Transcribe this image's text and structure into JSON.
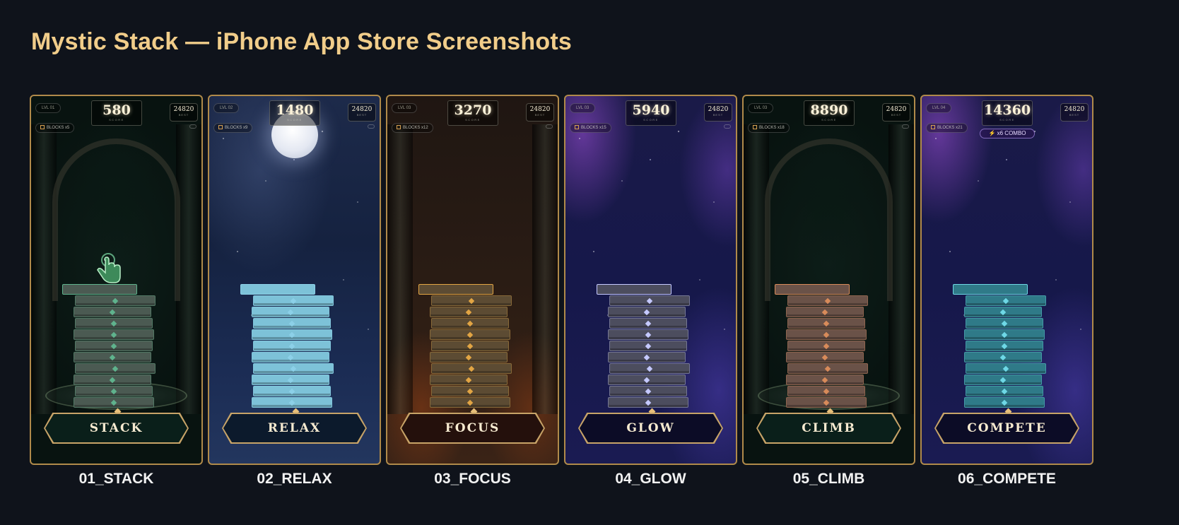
{
  "page": {
    "title": "Mystic Stack — iPhone App Store Screenshots"
  },
  "hud": {
    "score_label": "SCORE",
    "best_label": "BEST",
    "best_value": "24820"
  },
  "screens": [
    {
      "caption": "01_STACK",
      "banner": "STACK",
      "score": "580",
      "level": "LVL 01",
      "blocks": "BLOCKS x5",
      "theme": "forest",
      "accent": "#5fb38d",
      "block_color": "#4b5a52",
      "banner_bg": "#0a1f1a",
      "combo": ""
    },
    {
      "caption": "02_RELAX",
      "banner": "RELAX",
      "score": "1480",
      "level": "LVL 02",
      "blocks": "BLOCKS x9",
      "theme": "moon",
      "accent": "#8cd0e8",
      "block_color": "#7dc2d8",
      "banner_bg": "#0c1a2c",
      "combo": ""
    },
    {
      "caption": "03_FOCUS",
      "banner": "FOCUS",
      "score": "3270",
      "level": "LVL 03",
      "blocks": "BLOCKS x12",
      "theme": "amber",
      "accent": "#e2a544",
      "block_color": "#5c4b33",
      "banner_bg": "#24100c",
      "combo": ""
    },
    {
      "caption": "04_GLOW",
      "banner": "GLOW",
      "score": "5940",
      "level": "LVL 03",
      "blocks": "BLOCKS x15",
      "theme": "galaxy",
      "accent": "#c5c9ff",
      "block_color": "#4c4d5e",
      "banner_bg": "#0c0c26",
      "combo": ""
    },
    {
      "caption": "05_CLIMB",
      "banner": "CLIMB",
      "score": "8890",
      "level": "LVL 03",
      "blocks": "BLOCKS x18",
      "theme": "forest",
      "accent": "#d88b5a",
      "block_color": "#6a5248",
      "banner_bg": "#0a1f1a",
      "combo": ""
    },
    {
      "caption": "06_COMPETE",
      "banner": "COMPETE",
      "score": "14360",
      "level": "LVL 04",
      "blocks": "BLOCKS x21",
      "theme": "galaxy",
      "accent": "#6ed8e6",
      "block_color": "#2f7a88",
      "banner_bg": "#0c0c26",
      "combo": "x6 COMBO"
    }
  ]
}
